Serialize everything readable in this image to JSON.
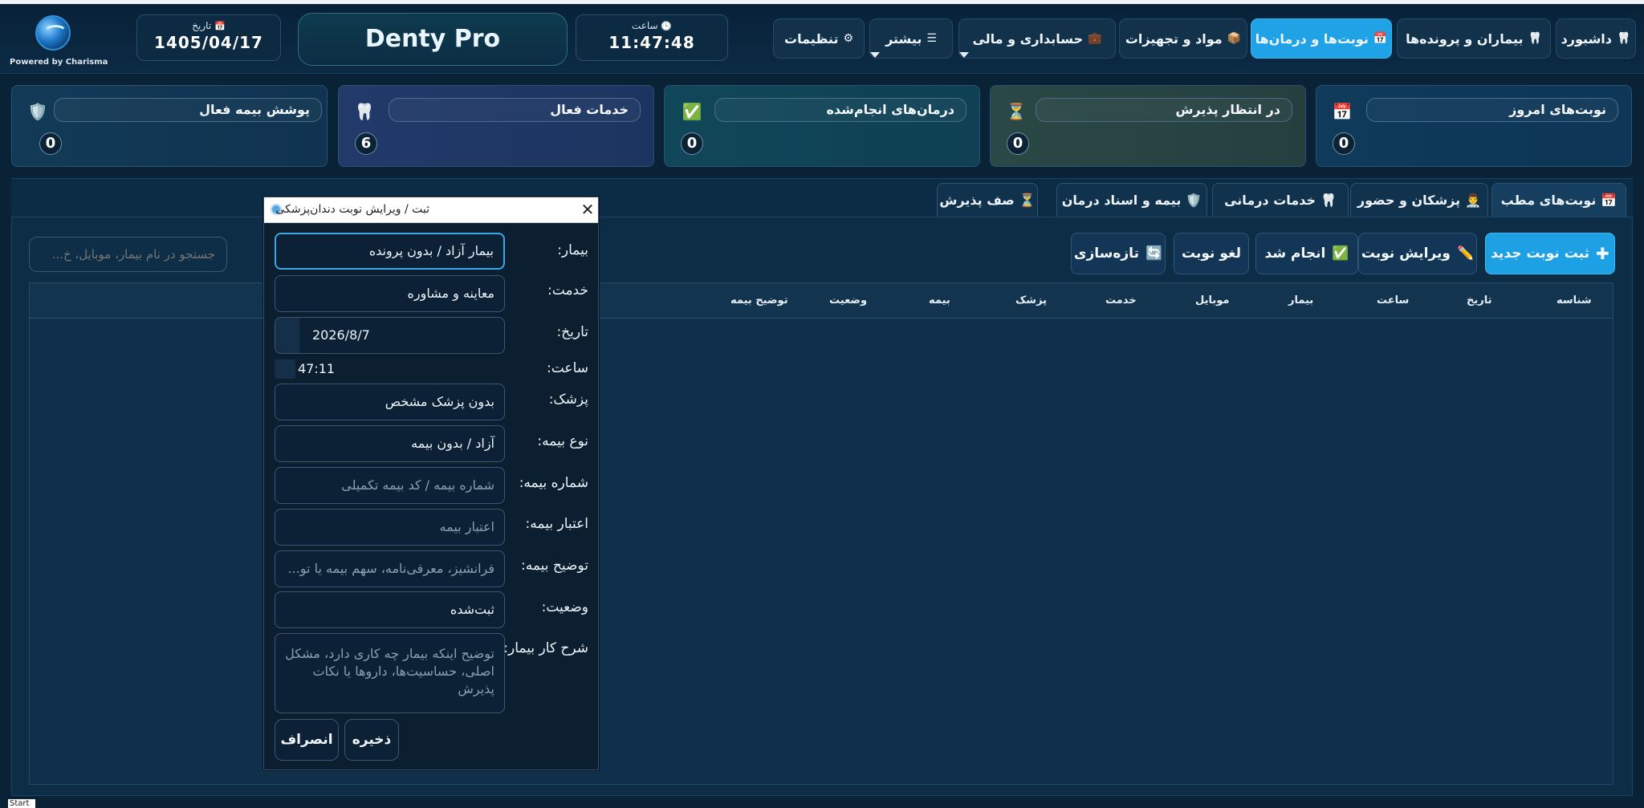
{
  "header": {
    "powered_by": "Powered by Charisma",
    "date_label": "تاریخ",
    "date_value": "1405/04/17",
    "time_label": "ساعت",
    "time_value": "11:47:48",
    "brand": "Denty Pro",
    "nav": {
      "dashboard": "داشبورد",
      "patients": "بیماران و پرونده‌ها",
      "appointments": "نوبت‌ها و درمان‌ها",
      "materials": "مواد و تجهیزات",
      "accounting": "حسابداری و مالی",
      "more": "بیشتر",
      "settings": "تنظیمات"
    }
  },
  "stats": {
    "today": {
      "label": "نوبت‌های امروز",
      "value": "0"
    },
    "waiting": {
      "label": "در انتظار پذیرش",
      "value": "0"
    },
    "done": {
      "label": "درمان‌های انجام‌شده",
      "value": "0"
    },
    "services": {
      "label": "خدمات فعال",
      "value": "6"
    },
    "insurance": {
      "label": "پوشش بیمه فعال",
      "value": "0"
    }
  },
  "tabs": {
    "clinic_appointments": "نوبت‌های مطب",
    "doctors": "پزشکان و حضور",
    "services": "خدمات درمانی",
    "insurance": "بیمه و اسناد درمان",
    "queue": "صف پذیرش"
  },
  "toolbar": {
    "new": "ثبت نوبت جدید",
    "edit": "ویرایش نوبت",
    "done": "انجام شد",
    "cancel": "لغو نوبت",
    "refresh": "تازه‌سازی",
    "search_placeholder": "جستجو در نام بیمار، موبایل، خ..."
  },
  "table": {
    "columns": [
      "شناسه",
      "تاریخ",
      "ساعت",
      "بیمار",
      "موبایل",
      "خدمت",
      "پزشک",
      "بیمه",
      "وضعیت",
      "توضیح بیمه"
    ]
  },
  "dialog": {
    "title": "ثبت / ویرایش نوبت دندان‌پزشکی",
    "labels": {
      "patient": "بیمار:",
      "service": "خدمت:",
      "date": "تاریخ:",
      "time": "ساعت:",
      "doctor": "پزشک:",
      "insurance_type": "نوع بیمه:",
      "insurance_number": "شماره بیمه:",
      "insurance_credit": "اعتبار بیمه:",
      "insurance_desc": "توضیح بیمه:",
      "status": "وضعیت:",
      "description": "شرح کار بیمار:"
    },
    "values": {
      "patient": "بیمار آزاد / بدون پرونده",
      "service": "معاینه و مشاوره",
      "date": "2026/8/7",
      "time": "47:11",
      "doctor": "بدون پزشک مشخص",
      "insurance_type": "آزاد / بدون بیمه",
      "status": "ثبت‌شده"
    },
    "placeholders": {
      "insurance_number": "شماره بیمه / کد بیمه تکمیلی",
      "insurance_credit": "اعتبار بیمه",
      "insurance_desc": "فرانشیز، معرفی‌نامه، سهم بیمه یا تو...",
      "description": "توضیح اینکه بیمار چه کاری دارد، مشکل اصلی، حساسیت‌ها، داروها یا نکات پذیرش"
    },
    "buttons": {
      "save": "ذخیره",
      "cancel": "انصراف"
    }
  },
  "taskbar": {
    "start": "Start"
  },
  "colors": {
    "accent": "#1fa2e6",
    "background": "#0a2236"
  }
}
